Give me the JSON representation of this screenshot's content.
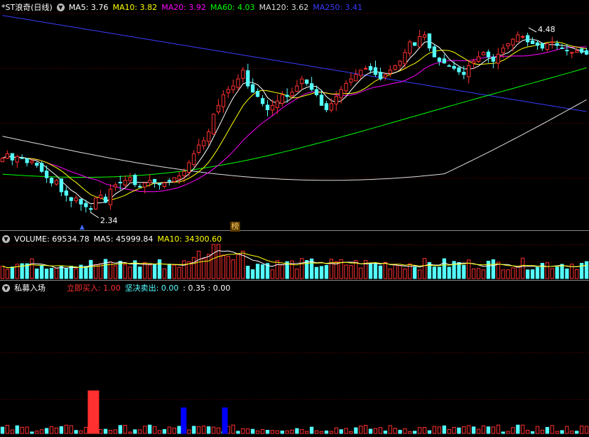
{
  "colors": {
    "up": "#ff3030",
    "down": "#54ffff",
    "ma5": "#ffffff",
    "ma10": "#ffff00",
    "ma20": "#ff00ff",
    "ma60": "#00ff00",
    "ma120": "#dcdcdc",
    "ma250": "#3a3aff",
    "grid": "#7a0000",
    "blue_signal": "#0000ff"
  },
  "price_panel": {
    "title": "*ST浪奇(日线)",
    "toggle_icon": "chevron-down-icon",
    "ma5_label": "MA5: 3.76",
    "ma10_label": "MA10: 3.82",
    "ma20_label": "MA20: 3.92",
    "ma60_label": "MA60: 4.03",
    "ma120_label": "MA120: 3.62",
    "ma250_label": "MA250: 3.41",
    "high_label": "4.48",
    "low_label": "2.34",
    "marker_label": "榜"
  },
  "volume_panel": {
    "volume_label": "VOLUME: 69534.78",
    "ma5_label": "MA5: 45999.84",
    "ma10_label": "MA10: 34300.60"
  },
  "indicator_panel": {
    "title": "私募入场",
    "buy_label": "立即买入: 1.00",
    "sell_label": "坚决卖出: 0.00",
    "extra_label": ": 0.35 : 0.00"
  },
  "chart_data": [
    {
      "type": "candlestick",
      "title": "*ST浪奇(日线)",
      "ylim": [
        2.2,
        4.65
      ],
      "annotations": [
        {
          "text": "4.48",
          "value": 4.48
        },
        {
          "text": "2.34",
          "value": 2.34
        }
      ],
      "close": [
        3.0,
        3.05,
        2.98,
        3.02,
        3.0,
        2.95,
        2.97,
        2.92,
        2.85,
        2.78,
        2.72,
        2.75,
        2.62,
        2.58,
        2.52,
        2.55,
        2.48,
        2.45,
        2.42,
        2.55,
        2.58,
        2.5,
        2.65,
        2.7,
        2.72,
        2.75,
        2.78,
        2.7,
        2.68,
        2.72,
        2.75,
        2.73,
        2.7,
        2.72,
        2.74,
        2.78,
        2.8,
        2.85,
        2.95,
        3.05,
        3.15,
        3.2,
        3.3,
        3.5,
        3.6,
        3.72,
        3.78,
        3.82,
        3.9,
        4.0,
        3.82,
        3.75,
        3.7,
        3.62,
        3.55,
        3.6,
        3.65,
        3.72,
        3.7,
        3.75,
        3.82,
        3.9,
        3.85,
        3.78,
        3.72,
        3.6,
        3.55,
        3.62,
        3.7,
        3.78,
        3.85,
        3.9,
        3.95,
        4.0,
        4.02,
        4.0,
        3.95,
        3.9,
        3.95,
        4.0,
        4.05,
        4.1,
        4.2,
        4.32,
        4.28,
        4.38,
        4.4,
        4.25,
        4.15,
        4.1,
        4.08,
        4.05,
        4.02,
        3.98,
        3.95,
        4.05,
        4.1,
        4.15,
        4.2,
        4.15,
        4.1,
        4.18,
        4.25,
        4.3,
        4.35,
        4.4,
        4.38,
        4.32,
        4.3,
        4.28,
        4.25,
        4.3,
        4.32,
        4.28,
        4.25,
        4.22,
        4.2,
        4.22,
        4.2,
        4.18
      ],
      "ma5": [
        3.76
      ],
      "ma10": [
        3.82
      ],
      "ma20": [
        3.92
      ],
      "ma60": [
        4.03
      ],
      "ma120": [
        3.62
      ],
      "ma250": [
        3.41
      ]
    },
    {
      "type": "bar",
      "title": "VOLUME",
      "values": [
        69534.78
      ],
      "ma5": [
        45999.84
      ],
      "ma10": [
        34300.6
      ]
    },
    {
      "type": "bar",
      "title": "私募入场",
      "series": [
        {
          "name": "立即买入",
          "value": 1.0
        },
        {
          "name": "坚决卖出",
          "value": 0.0
        }
      ]
    }
  ]
}
